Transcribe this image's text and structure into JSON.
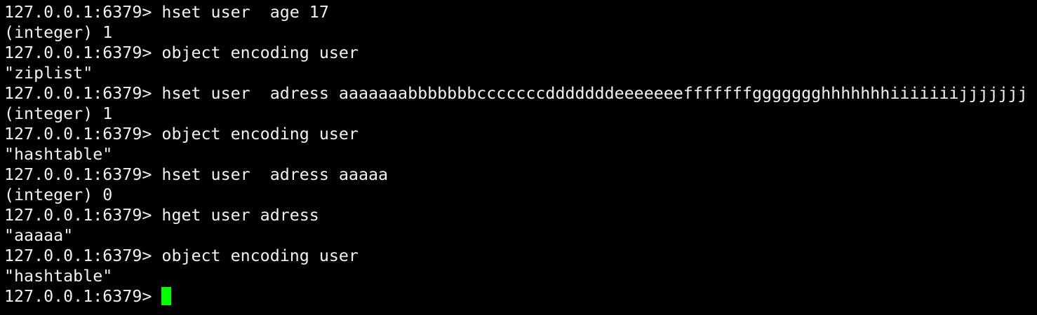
{
  "terminal": {
    "prompt": "127.0.0.1:6379> ",
    "lines": [
      {
        "kind": "command",
        "prompt": "127.0.0.1:6379> ",
        "text": "hset user  age 17"
      },
      {
        "kind": "output",
        "text": "(integer) 1"
      },
      {
        "kind": "command",
        "prompt": "127.0.0.1:6379> ",
        "text": "object encoding user"
      },
      {
        "kind": "output",
        "text": "\"ziplist\""
      },
      {
        "kind": "command",
        "prompt": "127.0.0.1:6379> ",
        "text": "hset user  adress aaaaaaabbbbbbbcccccccdddddddeeeeeeefffffffggggggghhhhhhhiiiiiiijjjjjjj"
      },
      {
        "kind": "output",
        "text": "(integer) 1"
      },
      {
        "kind": "command",
        "prompt": "127.0.0.1:6379> ",
        "text": "object encoding user"
      },
      {
        "kind": "output",
        "text": "\"hashtable\""
      },
      {
        "kind": "command",
        "prompt": "127.0.0.1:6379> ",
        "text": "hset user  adress aaaaa"
      },
      {
        "kind": "output",
        "text": "(integer) 0"
      },
      {
        "kind": "command",
        "prompt": "127.0.0.1:6379> ",
        "text": "hget user adress"
      },
      {
        "kind": "output",
        "text": "\"aaaaa\""
      },
      {
        "kind": "command",
        "prompt": "127.0.0.1:6379> ",
        "text": "object encoding user"
      },
      {
        "kind": "output",
        "text": "\"hashtable\""
      }
    ],
    "current_input": "",
    "colors": {
      "background": "#000000",
      "foreground": "#f2f2f2",
      "cursor": "#00ff00"
    }
  }
}
